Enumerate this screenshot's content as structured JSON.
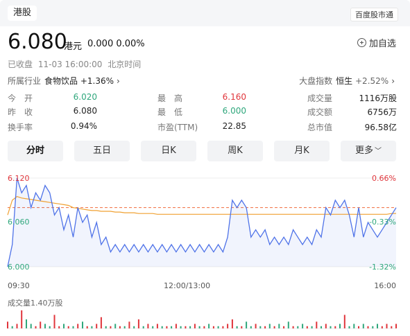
{
  "header": {
    "market_tag": "港股",
    "app_tag": "百度股市通"
  },
  "quote": {
    "price": "6.080",
    "unit": "港元",
    "change": "0.000",
    "change_pct": "0.00%"
  },
  "watchlist_label": "加自选",
  "status": {
    "state": "已收盘",
    "time": "11-03 16:00:00",
    "zone": "北京时间"
  },
  "industry": {
    "label": "所属行业",
    "name": "食物饮品",
    "change": "+1.36%"
  },
  "index": {
    "label": "大盘指数",
    "name": "恒生",
    "change": "+2.52%"
  },
  "stats": {
    "open_label": "今　开",
    "open": "6.020",
    "prev_label": "昨　收",
    "prev": "6.080",
    "turnover_label": "换手率",
    "turnover": "0.94%",
    "high_label": "最　高",
    "high": "6.160",
    "low_label": "最　低",
    "low": "6.000",
    "pe_label": "市盈(TTM)",
    "pe": "22.85",
    "volume_label": "成交量",
    "volume": "1116万股",
    "amount_label": "成交额",
    "amount": "6756万",
    "mcap_label": "总市值",
    "mcap": "96.58亿"
  },
  "tabs": [
    "分时",
    "五日",
    "日K",
    "周K",
    "月K",
    "更多"
  ],
  "colors": {
    "up": "#e0353b",
    "down": "#2fa77c",
    "price_line": "#4e72e8",
    "avg_line": "#f0a030",
    "ref_line": "#f06a3a"
  },
  "chart_data": {
    "type": "line",
    "y_left_ticks": [
      "6.120",
      "6.060",
      "6.000"
    ],
    "y_right_ticks": [
      "0.66%",
      "-0.33%",
      "-1.32%"
    ],
    "x_ticks": [
      "09:30",
      "12:00/13:00",
      "16:00"
    ],
    "ylim": [
      6.0,
      6.12
    ],
    "reference": 6.08,
    "volume_label": "成交量1.40万股",
    "series": [
      {
        "values": [
          6.0,
          6.03,
          6.12,
          6.1,
          6.11,
          6.08,
          6.1,
          6.09,
          6.11,
          6.1,
          6.07,
          6.08,
          6.05,
          6.07,
          6.04,
          6.08,
          6.06,
          6.07,
          6.04,
          6.06,
          6.03,
          6.04,
          6.02,
          6.03,
          6.02,
          6.03,
          6.02,
          6.03,
          6.02,
          6.03,
          6.02,
          6.03,
          6.02,
          6.03,
          6.02,
          6.03,
          6.02,
          6.03,
          6.02,
          6.03,
          6.02,
          6.03,
          6.02,
          6.03,
          6.02,
          6.03,
          6.02,
          6.04,
          6.09,
          6.08,
          6.09,
          6.08,
          6.04,
          6.05,
          6.04,
          6.05,
          6.03,
          6.04,
          6.03,
          6.04,
          6.03,
          6.05,
          6.04,
          6.03,
          6.04,
          6.03,
          6.05,
          6.04,
          6.08,
          6.07,
          6.09,
          6.08,
          6.09,
          6.07,
          6.04,
          6.08,
          6.04,
          6.06,
          6.05,
          6.04,
          6.05,
          6.06,
          6.07,
          6.08
        ]
      },
      {
        "values": [
          6.07,
          6.09,
          6.095,
          6.093,
          6.092,
          6.091,
          6.09,
          6.089,
          6.088,
          6.087,
          6.086,
          6.085,
          6.084,
          6.083,
          6.08,
          6.079,
          6.078,
          6.077,
          6.076,
          6.076,
          6.075,
          6.075,
          6.075,
          6.074,
          6.074,
          6.073,
          6.073,
          6.073,
          6.072,
          6.072,
          6.072,
          6.072,
          6.071,
          6.071,
          6.071,
          6.071,
          6.071,
          6.071,
          6.071,
          6.071,
          6.071,
          6.071,
          6.071,
          6.071,
          6.071,
          6.071,
          6.071,
          6.071,
          6.071,
          6.071,
          6.071,
          6.071,
          6.071,
          6.071,
          6.071,
          6.071,
          6.071,
          6.071,
          6.071,
          6.071,
          6.071,
          6.071,
          6.071,
          6.071,
          6.071,
          6.071,
          6.071,
          6.071,
          6.071,
          6.071,
          6.071,
          6.071,
          6.071,
          6.071,
          6.071,
          6.071,
          6.071,
          6.071,
          6.071,
          6.071,
          6.071,
          6.071,
          6.072,
          6.072
        ]
      }
    ],
    "volume": [
      3,
      1,
      2,
      8,
      4,
      2,
      1,
      3,
      2,
      1,
      6,
      1,
      2,
      1,
      1,
      2,
      3,
      1,
      1,
      2,
      5,
      1,
      1,
      2,
      1,
      1,
      3,
      1,
      4,
      1,
      2,
      1,
      2,
      1,
      1,
      1,
      2,
      1,
      1,
      1,
      2,
      1,
      1,
      2,
      1,
      1,
      1,
      2,
      4,
      1,
      1,
      3,
      1,
      2,
      1,
      1,
      2,
      1,
      2,
      1,
      3,
      1,
      1,
      2,
      1,
      1,
      3,
      1,
      2,
      1,
      1,
      2,
      6,
      1,
      2,
      1,
      2,
      1,
      1,
      2,
      1,
      2,
      1,
      2
    ],
    "volume_up": [
      1,
      0,
      1,
      1,
      0,
      0,
      1,
      1,
      0,
      0,
      1,
      1,
      0,
      1,
      0,
      1,
      0,
      1,
      0,
      1,
      1,
      0,
      1,
      0,
      1,
      0,
      1,
      0,
      1,
      0,
      1,
      0,
      1,
      0,
      1,
      0,
      1,
      0,
      1,
      0,
      1,
      0,
      1,
      0,
      1,
      0,
      1,
      1,
      1,
      0,
      1,
      0,
      0,
      1,
      0,
      1,
      0,
      1,
      0,
      1,
      0,
      1,
      0,
      0,
      1,
      0,
      1,
      0,
      1,
      0,
      1,
      0,
      1,
      0,
      0,
      1,
      0,
      1,
      0,
      0,
      1,
      1,
      1,
      1
    ]
  }
}
